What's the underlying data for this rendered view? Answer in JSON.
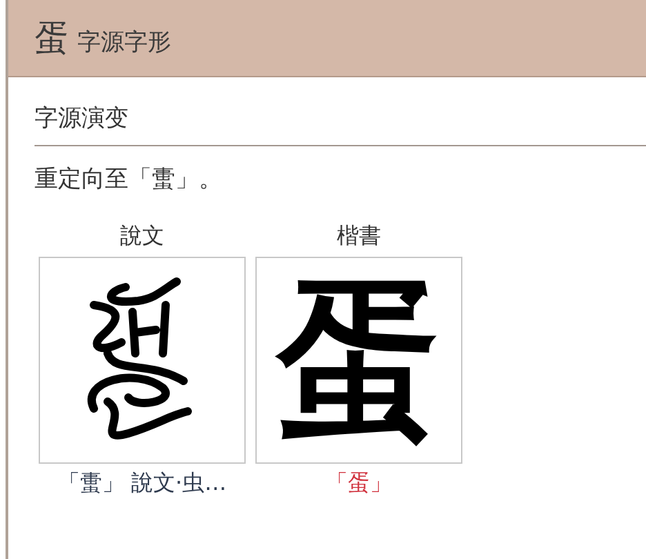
{
  "header": {
    "character": "蛋",
    "title": "字源字形"
  },
  "section": {
    "title": "字源演变",
    "note": "重定向至「蟗」。"
  },
  "forms": [
    {
      "label": "說文",
      "kind": "seal",
      "caption": "「蟗」 說文·虫…",
      "highlight": false
    },
    {
      "label": "楷書",
      "kind": "regular",
      "glyph": "蛋",
      "caption": "「蛋」",
      "highlight": true
    }
  ]
}
